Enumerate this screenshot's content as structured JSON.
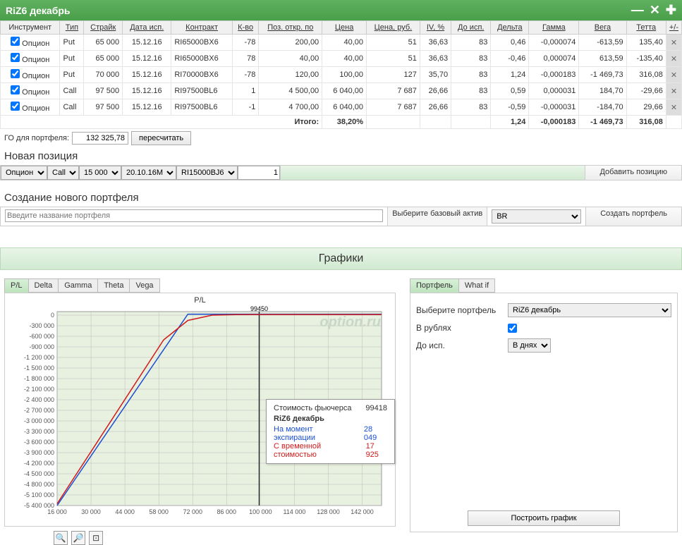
{
  "title": "RiZ6 декабрь",
  "columns": [
    "Инструмент",
    "Тип",
    "Страйк",
    "Дата исп.",
    "Контракт",
    "К-во",
    "Поз. откр. по",
    "Цена",
    "Цена, руб.",
    "IV, %",
    "До исп.",
    "Дельта",
    "Гамма",
    "Вега",
    "Тетта",
    "+/-"
  ],
  "rows": [
    {
      "instr": "Опцион",
      "type": "Put",
      "strike": "65 000",
      "date": "15.12.16",
      "contract": "RI65000BX6",
      "qty": "-78",
      "openpos": "200,00",
      "price": "40,00",
      "pricerub": "51",
      "iv": "36,63",
      "days": "83",
      "delta": "0,46",
      "gamma": "-0,000074",
      "vega": "-613,59",
      "theta": "135,40"
    },
    {
      "instr": "Опцион",
      "type": "Put",
      "strike": "65 000",
      "date": "15.12.16",
      "contract": "RI65000BX6",
      "qty": "78",
      "openpos": "40,00",
      "price": "40,00",
      "pricerub": "51",
      "iv": "36,63",
      "days": "83",
      "delta": "-0,46",
      "gamma": "0,000074",
      "vega": "613,59",
      "theta": "-135,40"
    },
    {
      "instr": "Опцион",
      "type": "Put",
      "strike": "70 000",
      "date": "15.12.16",
      "contract": "RI70000BX6",
      "qty": "-78",
      "openpos": "120,00",
      "price": "100,00",
      "pricerub": "127",
      "iv": "35,70",
      "days": "83",
      "delta": "1,24",
      "gamma": "-0,000183",
      "vega": "-1 469,73",
      "theta": "316,08"
    },
    {
      "instr": "Опцион",
      "type": "Call",
      "strike": "97 500",
      "date": "15.12.16",
      "contract": "RI97500BL6",
      "qty": "1",
      "openpos": "4 500,00",
      "price": "6 040,00",
      "pricerub": "7 687",
      "iv": "26,66",
      "days": "83",
      "delta": "0,59",
      "gamma": "0,000031",
      "vega": "184,70",
      "theta": "-29,66"
    },
    {
      "instr": "Опцион",
      "type": "Call",
      "strike": "97 500",
      "date": "15.12.16",
      "contract": "RI97500BL6",
      "qty": "-1",
      "openpos": "4 700,00",
      "price": "6 040,00",
      "pricerub": "7 687",
      "iv": "26,66",
      "days": "83",
      "delta": "-0,59",
      "gamma": "-0,000031",
      "vega": "-184,70",
      "theta": "29,66"
    }
  ],
  "totals": {
    "label": "Итого:",
    "price": "38,20%",
    "delta": "1,24",
    "gamma": "-0,000183",
    "vega": "-1 469,73",
    "theta": "316,08"
  },
  "go": {
    "label": "ГО для портфеля:",
    "value": "132 325,78",
    "recalc": "пересчитать"
  },
  "newpos": {
    "heading": "Новая позиция",
    "instr": "Опцион",
    "type": "Call",
    "strike": "15 000",
    "date": "20.10.16M",
    "contract": "RI15000BJ6",
    "qty": "1",
    "add": "Добавить позицию"
  },
  "createport": {
    "heading": "Создание нового портфеля",
    "placeholder": "Введите название портфеля",
    "baselabel": "Выберите базовый актив",
    "base": "BR",
    "create": "Создать портфель"
  },
  "charts_header": "Графики",
  "chart_tabs": [
    "P/L",
    "Delta",
    "Gamma",
    "Theta",
    "Vega"
  ],
  "chart_title": "P/L",
  "chart_marker": "99450",
  "watermark": "option.ru",
  "tooltip": {
    "futlabel": "Стоимость фьючерса",
    "futval": "99418",
    "title": "RiZ6 декабрь",
    "explabel": "На момент экспирации",
    "expval": "28 049",
    "tvlabel": "С временной стоимостью",
    "tvval": "17 925"
  },
  "right_tabs": [
    "Портфель",
    "What if"
  ],
  "right": {
    "sel_port_label": "Выберите портфель",
    "sel_port": "RiZ6 декабрь",
    "rub_label": "В рублях",
    "days_label": "До исп.",
    "days": "В днях",
    "build": "Построить график"
  },
  "chart_data": {
    "type": "line",
    "xlabel": "",
    "ylabel": "P/L",
    "xlim": [
      16000,
      150000
    ],
    "ylim": [
      -5400000,
      100000
    ],
    "x_ticks": [
      16000,
      30000,
      44000,
      58000,
      72000,
      86000,
      100000,
      114000,
      128000,
      142000
    ],
    "y_ticks": [
      0,
      -300000,
      -600000,
      -900000,
      -1200000,
      -1500000,
      -1800000,
      -2100000,
      -2400000,
      -2700000,
      -3000000,
      -3300000,
      -3600000,
      -3900000,
      -4200000,
      -4500000,
      -4800000,
      -5100000,
      -5400000
    ],
    "series": [
      {
        "name": "На момент экспирации",
        "color": "#1a4fd0",
        "points": [
          [
            16000,
            -5400000
          ],
          [
            70000,
            28000
          ],
          [
            150000,
            28000
          ]
        ]
      },
      {
        "name": "С временной стоимостью",
        "color": "#d01a1a",
        "points": [
          [
            16000,
            -5350000
          ],
          [
            60000,
            -700000
          ],
          [
            70000,
            -150000
          ],
          [
            80000,
            0
          ],
          [
            90000,
            14000
          ],
          [
            100000,
            18000
          ],
          [
            150000,
            18000
          ]
        ]
      }
    ],
    "vline": 99450
  }
}
